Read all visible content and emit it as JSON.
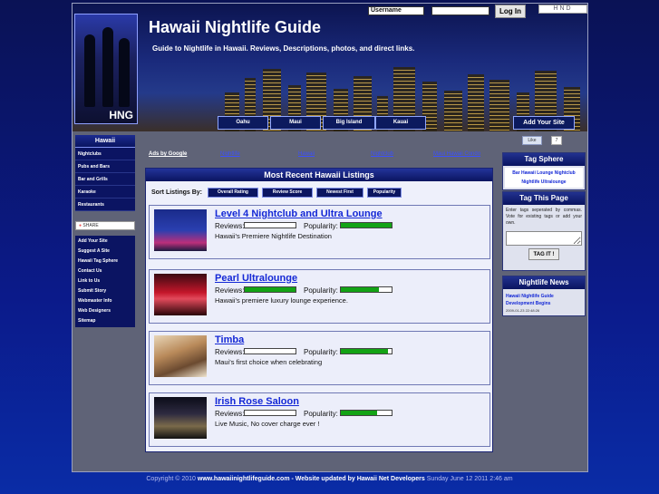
{
  "header": {
    "site_title": "Hawaii Nightlife Guide",
    "tagline": "Guide to Nightlife in Hawaii. Reviews, Descriptions, photos, and direct links.",
    "logo_text": "HNG",
    "badge_text": "HND"
  },
  "login": {
    "username_label": "Username",
    "password_value": "",
    "button_label": "Log In"
  },
  "nav_tabs": [
    "Oahu",
    "Maui",
    "Big Island",
    "Kauai"
  ],
  "add_site_tab": "Add Your Site",
  "sidebar": {
    "heading": "Hawaii",
    "categories": [
      "Nightclubs",
      "Pubs and Bars",
      "Bar and Grills",
      "Karaoke",
      "Restaurants"
    ],
    "share_label": "SHARE",
    "links": [
      "Add Your Site",
      "Suggest A Site",
      "Hawaii Tag Sphere",
      "Contact Us",
      "Link to Us",
      "Submit Story",
      "Webmaster Info",
      "Web Designers",
      "Sitemap"
    ]
  },
  "ads": {
    "label": "Ads by Google",
    "links": [
      "Nightlife",
      "Hawaii",
      "Nightclub",
      "Maui Hawaii Condo"
    ]
  },
  "main": {
    "heading": "Most Recent Hawaii Listings",
    "sort_label": "Sort Listings By:",
    "sort_options": [
      "Overall Rating",
      "Review Score",
      "Newest First",
      "Popularity"
    ],
    "review_label": "Reviews:",
    "popularity_label": "Popularity:",
    "listings": [
      {
        "title": "Level 4 Nightclub and Ultra Lounge",
        "description": "Hawaii's Premiere Nightlife Destination",
        "reviews": 0,
        "popularity": 1.0
      },
      {
        "title": "Pearl Ultralounge",
        "description": "Hawaii's premiere luxury lounge experience.",
        "reviews": 1.0,
        "popularity": 0.75
      },
      {
        "title": "Timba",
        "description": "Maui's first choice when celebrating",
        "reviews": 0,
        "popularity": 0.92
      },
      {
        "title": "Irish Rose Saloon",
        "description": "Live Music, No cover charge ever !",
        "reviews": 0,
        "popularity": 0.72
      }
    ]
  },
  "right": {
    "fb_like": "Like",
    "fb_count": "7",
    "tag_sphere_heading": "Tag Sphere",
    "tag_sphere_tags": "Bar Hawaii Lounge Nightclub Nightlife Ultralounge",
    "tag_page_heading": "Tag This Page",
    "tag_page_help": "Enter tags seperated by commas. Vote for existing tags or add your own.",
    "tag_input_value": "",
    "tag_button": "TAG IT !",
    "news_heading": "Nightlife News",
    "news_title": "Hawaii Nightlife Guide Development Begins",
    "news_date": "2009-01-23 22:48:26"
  },
  "footer": {
    "copyright": "Copyright © 2010",
    "domain": "www.hawaiinightlifeguide.com",
    "updated_by": "- Website updated by Hawaii Net Developers",
    "updated_on": "Sunday June 12 2011 2:46 am"
  },
  "colors": {
    "accent": "#1428d6",
    "nav_bg": "#0b1560",
    "bar_fill": "#13a315"
  }
}
